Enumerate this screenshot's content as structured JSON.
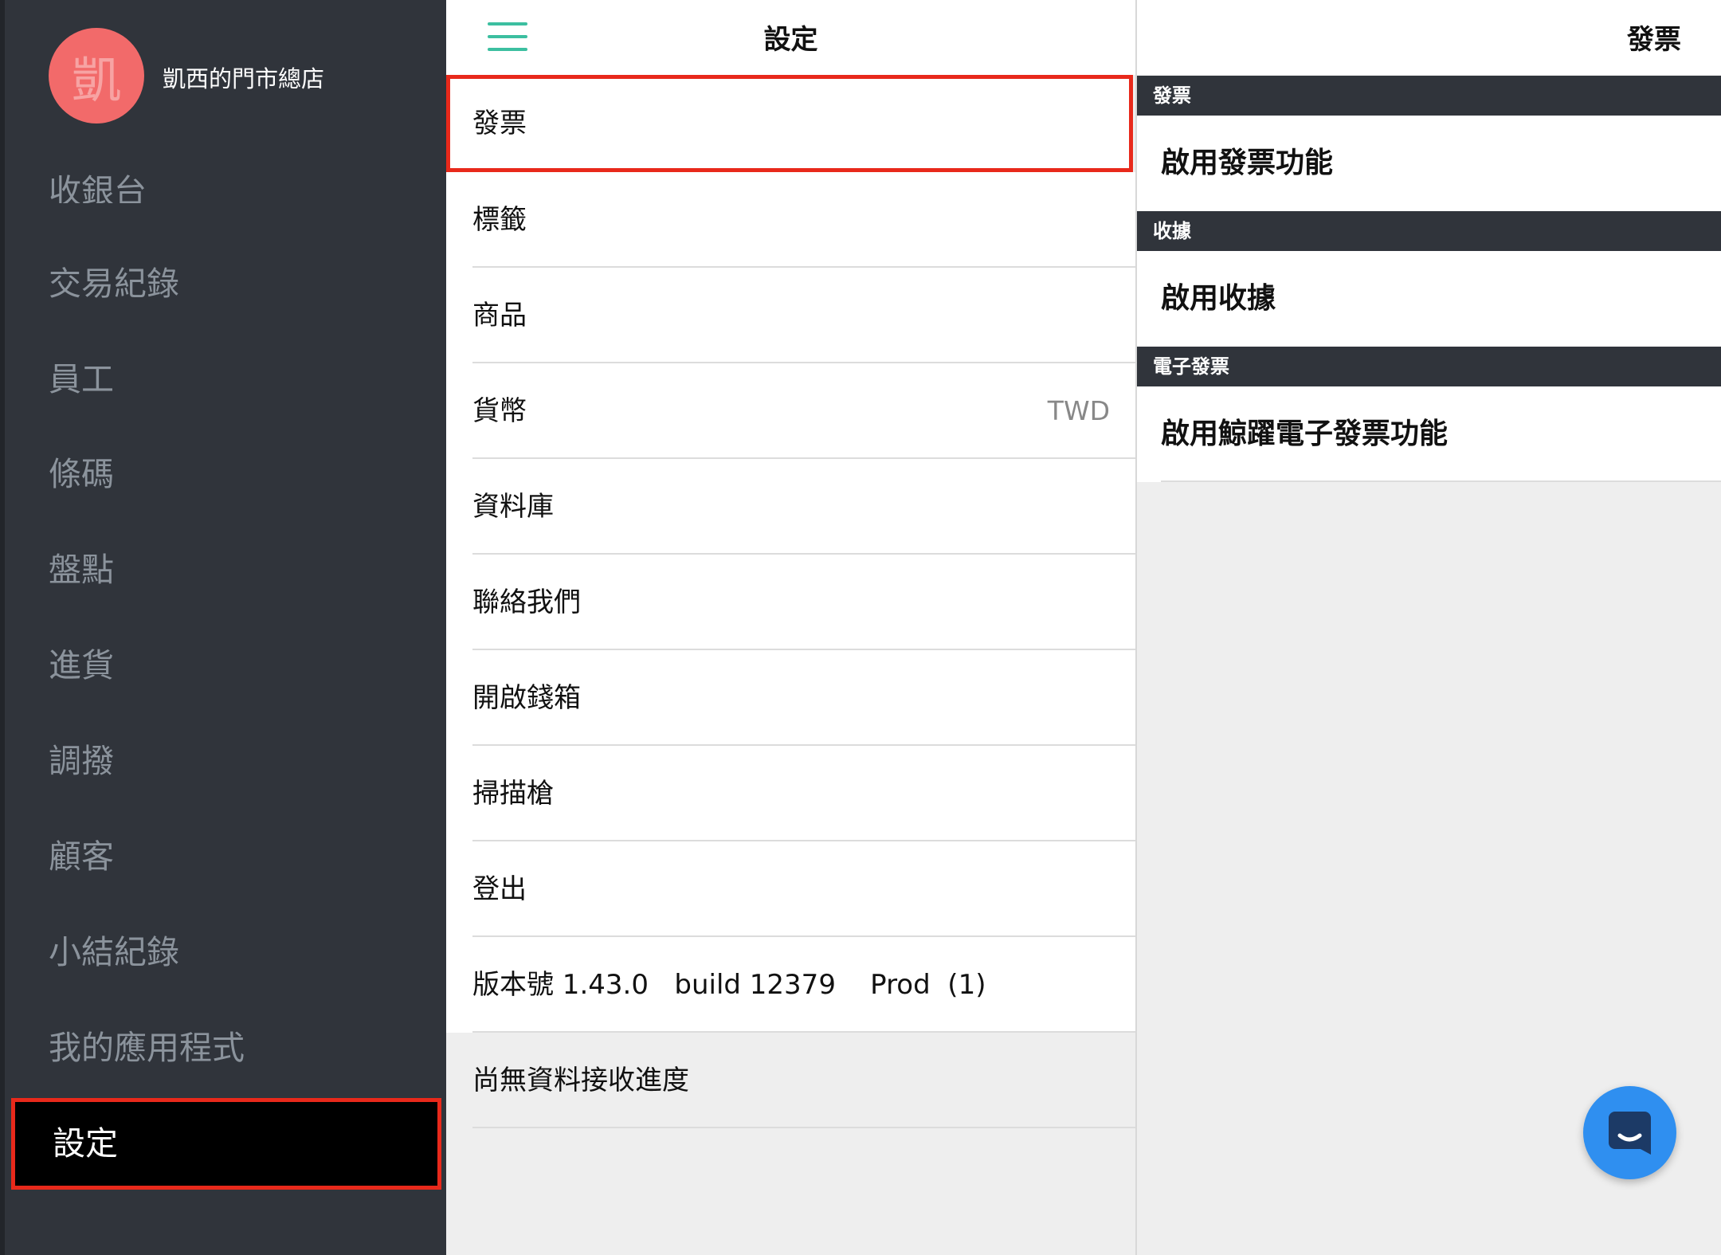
{
  "sidebar": {
    "avatar_initial": "凱",
    "store_name": "凱西的門市總店",
    "items": [
      {
        "label": "收銀台"
      },
      {
        "label": "交易紀錄"
      },
      {
        "label": "員工"
      },
      {
        "label": "條碼"
      },
      {
        "label": "盤點"
      },
      {
        "label": "進貨"
      },
      {
        "label": "調撥"
      },
      {
        "label": "顧客"
      },
      {
        "label": "小結紀錄"
      },
      {
        "label": "我的應用程式"
      }
    ],
    "active_item": "設定"
  },
  "settings": {
    "title": "設定",
    "items": [
      {
        "label": "發票",
        "value": ""
      },
      {
        "label": "標籤",
        "value": ""
      },
      {
        "label": "商品",
        "value": ""
      },
      {
        "label": "貨幣",
        "value": "TWD"
      },
      {
        "label": "資料庫",
        "value": ""
      },
      {
        "label": "聯絡我們",
        "value": ""
      },
      {
        "label": "開啟錢箱",
        "value": ""
      },
      {
        "label": "掃描槍",
        "value": ""
      },
      {
        "label": "登出",
        "value": ""
      },
      {
        "label": "版本號 1.43.0   build 12379    Prod  (1)",
        "value": ""
      },
      {
        "label": "尚無資料接收進度",
        "value": ""
      }
    ]
  },
  "invoice": {
    "title": "發票",
    "sections": [
      {
        "header": "發票",
        "row": "啟用發票功能"
      },
      {
        "header": "收據",
        "row": "啟用收據"
      },
      {
        "header": "電子發票",
        "row": "啟用鯨躍電子發票功能"
      }
    ]
  },
  "colors": {
    "sidebar_bg": "#30343b",
    "accent_green": "#3cbfa0",
    "highlight_red": "#e8291b",
    "avatar": "#f26a6a",
    "chat_blue": "#2f8ff0"
  },
  "icons": {
    "menu": "hamburger-icon",
    "chat": "chat-bubble-icon"
  }
}
